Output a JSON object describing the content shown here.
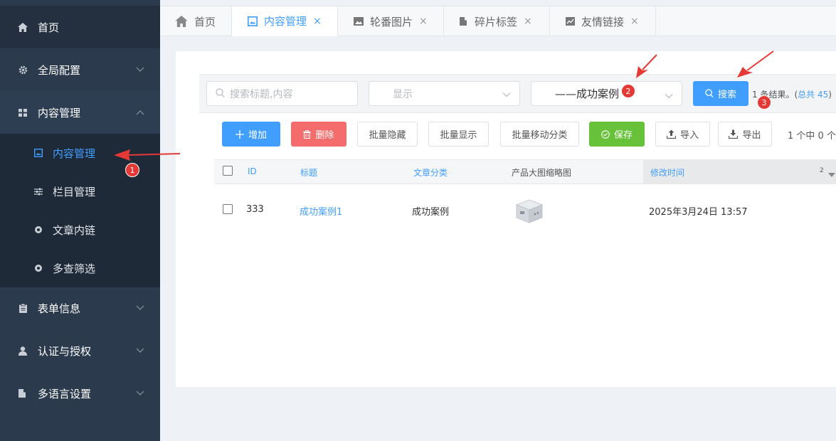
{
  "sidebar": {
    "items": [
      {
        "label": "首页",
        "icon": "home-icon"
      },
      {
        "label": "全局配置",
        "icon": "gear-icon"
      },
      {
        "label": "内容管理",
        "icon": "grid-icon"
      },
      {
        "label": "表单信息",
        "icon": "clipboard-icon"
      },
      {
        "label": "认证与授权",
        "icon": "user-icon"
      },
      {
        "label": "多语言设置",
        "icon": "book-icon"
      }
    ],
    "subitems": [
      {
        "label": "内容管理",
        "icon": "image-icon"
      },
      {
        "label": "栏目管理",
        "icon": "sliders-icon"
      },
      {
        "label": "文章内链",
        "icon": "circle-icon"
      },
      {
        "label": "多查筛选",
        "icon": "circle-icon"
      }
    ]
  },
  "tabs": [
    {
      "label": "首页",
      "icon": "home-icon"
    },
    {
      "label": "内容管理",
      "icon": "image-icon",
      "close": "×"
    },
    {
      "label": "轮番图片",
      "icon": "picture-icon",
      "close": "×"
    },
    {
      "label": "碎片标签",
      "icon": "book-icon",
      "close": "×"
    },
    {
      "label": "友情链接",
      "icon": "chart-icon",
      "close": "×"
    }
  ],
  "filters": {
    "search_placeholder": "搜索标题,内容",
    "display_select": "显示",
    "category_select": "——成功案例",
    "search_button": "搜索",
    "result_prefix": "1 条结果。(",
    "result_total": "总共 45",
    "result_suffix": ")"
  },
  "toolbar": {
    "add": "增加",
    "delete": "删除",
    "batch_hide": "批量隐藏",
    "batch_show": "批量显示",
    "batch_move": "批量移动分类",
    "save": "保存",
    "import": "导入",
    "export": "导出",
    "page_info": "1 个中 0 个"
  },
  "table": {
    "headers": [
      "ID",
      "标题",
      "文章分类",
      "产品大图缩略图",
      "修改时间"
    ],
    "sort_indicator": "2",
    "rows": [
      {
        "id": "333",
        "title": "成功案例1",
        "category": "成功案例",
        "modified": "2025年3月24日 13:57"
      }
    ]
  },
  "annotations": {
    "badge1": "1",
    "badge2": "2",
    "badge3": "3"
  },
  "colors": {
    "accent": "#409eff",
    "danger": "#f56c6c",
    "success": "#67c23a",
    "sidebar": "#2b3a4d",
    "annotation": "#e53935"
  }
}
